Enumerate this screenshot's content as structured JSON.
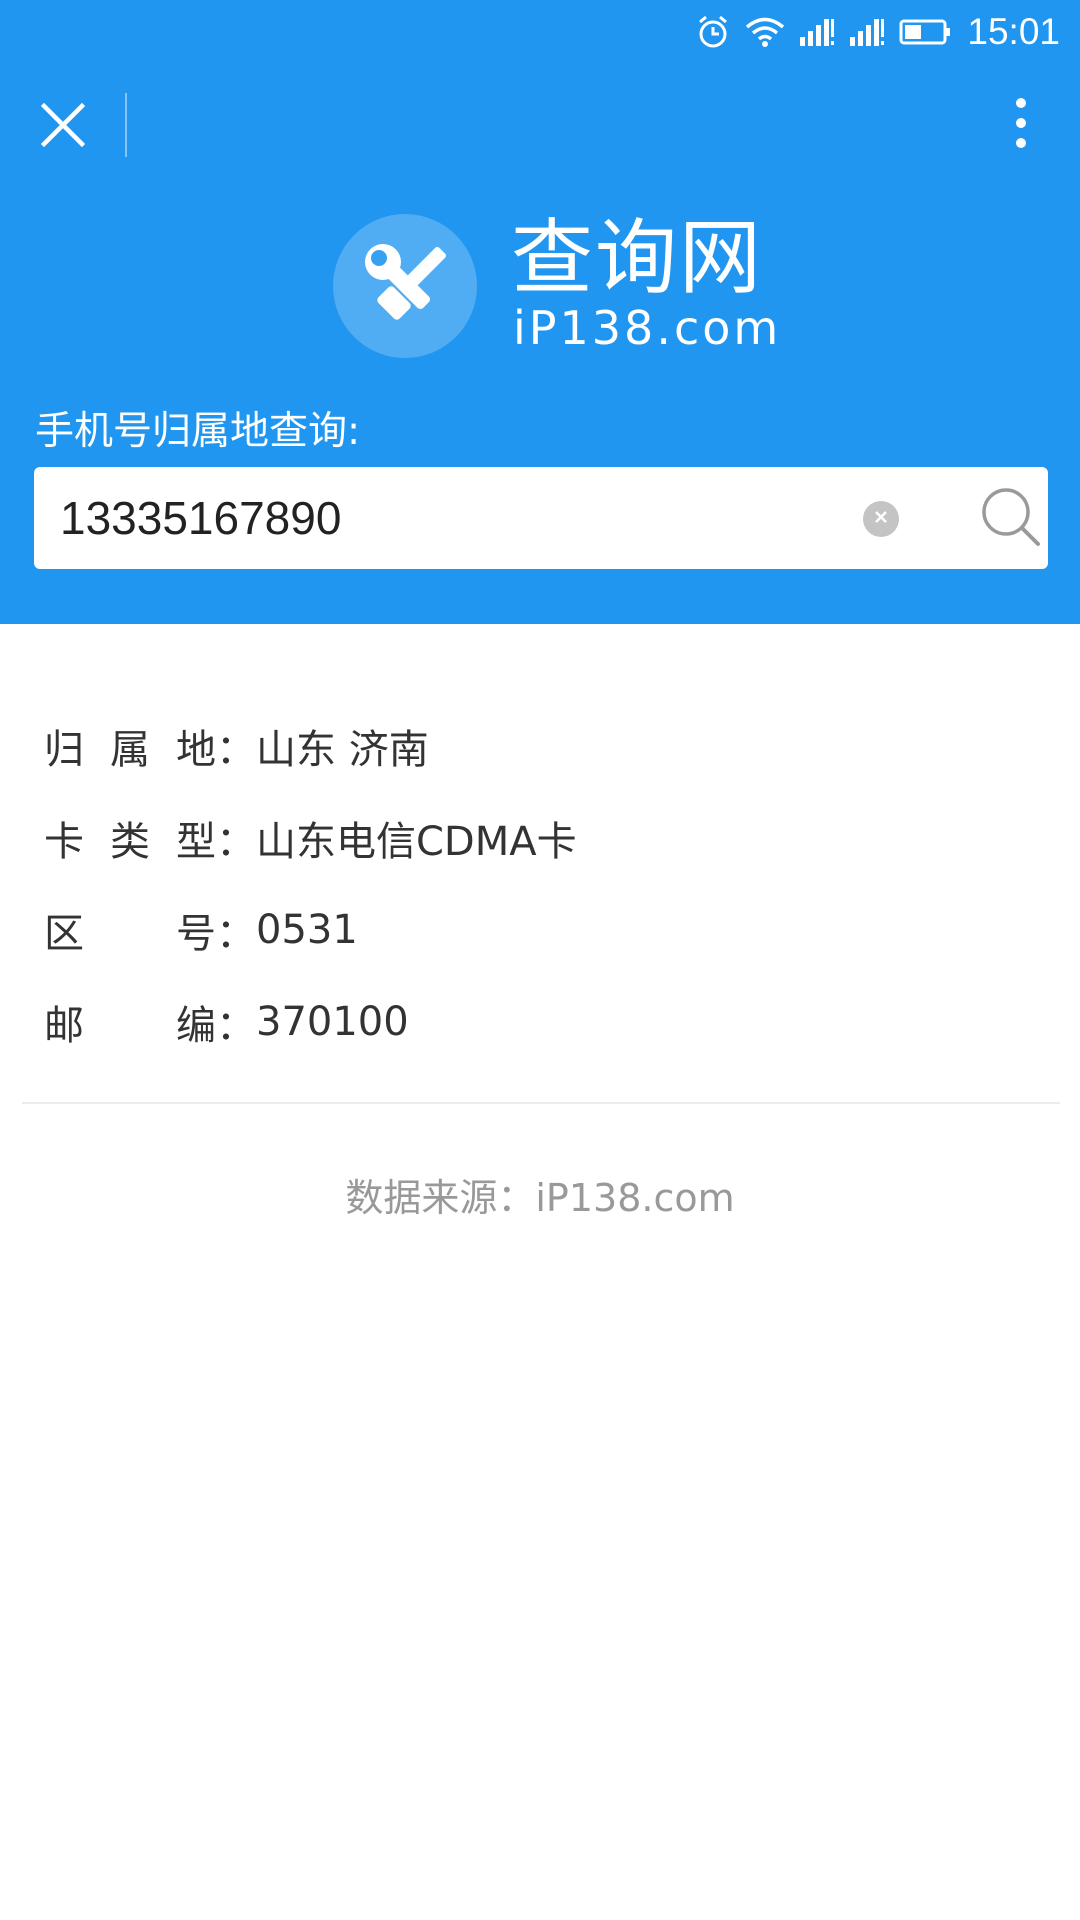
{
  "status_bar": {
    "time": "15:01",
    "icons": [
      "alarm-icon",
      "wifi-icon",
      "signal-icon",
      "signal-icon",
      "battery-icon"
    ]
  },
  "toolbar": {
    "close_icon": "close-icon",
    "more_icon": "more-vert-icon"
  },
  "logo": {
    "title": "查询网",
    "domain": "iP138.com",
    "icon": "tools-icon"
  },
  "search": {
    "label": "手机号归属地查询:",
    "value": "13335167890",
    "clear_icon": "clear-icon",
    "search_icon": "search-icon"
  },
  "results": [
    {
      "label": "归属地",
      "value": "山东 济南"
    },
    {
      "label": "卡类型",
      "value": "山东电信CDMA卡"
    },
    {
      "label": "区号",
      "value": "0531"
    },
    {
      "label": "邮编",
      "value": "370100"
    }
  ],
  "results_separator": "：",
  "footer": {
    "source": "数据来源：iP138.com"
  },
  "colors": {
    "primary": "#2196f0",
    "text": "#333333",
    "muted": "#999999"
  }
}
